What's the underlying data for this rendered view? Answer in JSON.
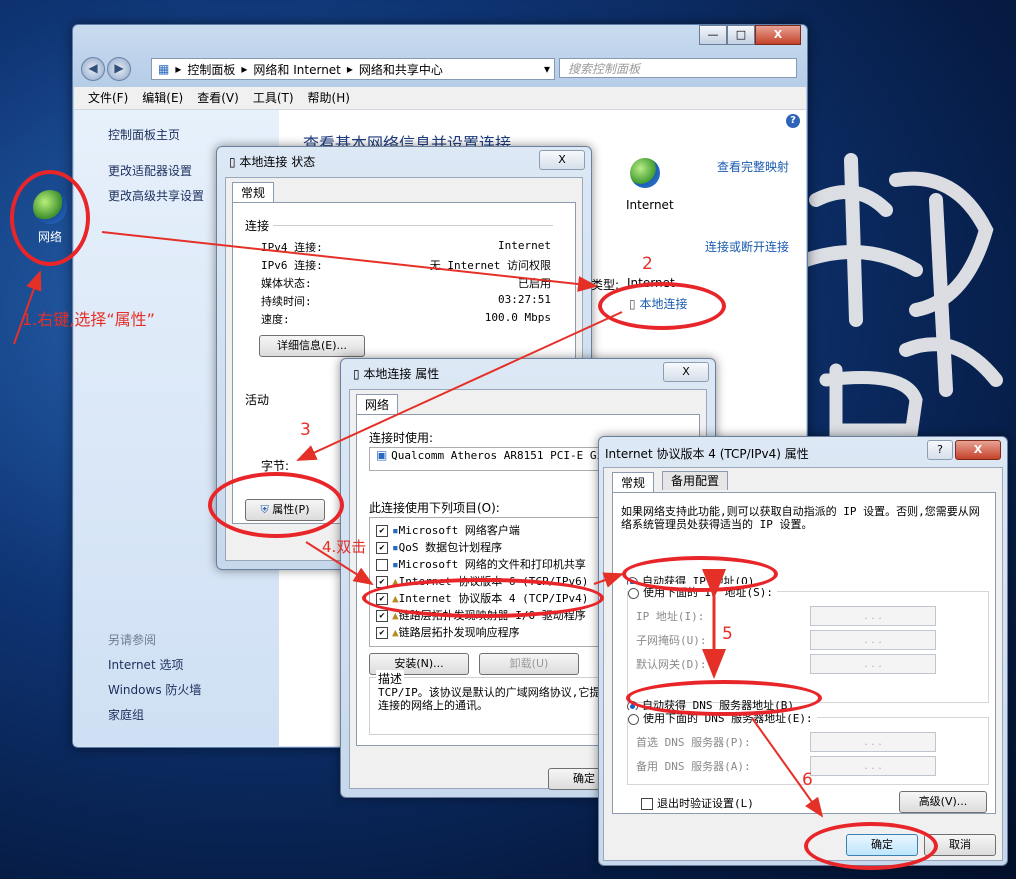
{
  "desktop": {
    "network_icon_label": "网络",
    "calligraphy": "坤 罗"
  },
  "explorer": {
    "title_buttons": {
      "minimize": "—",
      "maximize": "□",
      "close": "X"
    },
    "breadcrumb": [
      "控制面板",
      "网络和 Internet",
      "网络和共享中心"
    ],
    "search_placeholder": "搜索控制面板",
    "menu": [
      "文件(F)",
      "编辑(E)",
      "查看(V)",
      "工具(T)",
      "帮助(H)"
    ],
    "sidebar": {
      "items": [
        "控制面板主页",
        "更改适配器设置",
        "更改高级共享设置"
      ],
      "see_also_header": "另请参阅",
      "see_also": [
        "Internet 选项",
        "Windows 防火墙",
        "家庭组"
      ]
    },
    "content": {
      "title": "查看基本网络信息并设置连接",
      "view_full_map": "查看完整映射",
      "internet_label": "Internet",
      "connect_disconnect": "连接或断开连接",
      "type_label": "类型:",
      "type_value": "Internet",
      "local_connection_link": "本地连接"
    }
  },
  "status_dialog": {
    "title": "本地连接 状态",
    "tab": "常规",
    "section_connection": "连接",
    "rows": [
      {
        "label": "IPv4 连接:",
        "value": "Internet"
      },
      {
        "label": "IPv6 连接:",
        "value": "无 Internet 访问权限"
      },
      {
        "label": "媒体状态:",
        "value": "已启用"
      },
      {
        "label": "持续时间:",
        "value": "03:27:51"
      },
      {
        "label": "速度:",
        "value": "100.0 Mbps"
      }
    ],
    "details_button": "详细信息(E)...",
    "section_activity": "活动",
    "bytes_label": "字节:",
    "properties_button": "属性(P)"
  },
  "props_dialog": {
    "title": "本地连接 属性",
    "tab": "网络",
    "connect_using_label": "连接时使用:",
    "adapter": "Qualcomm Atheros AR8151 PCI-E Gig",
    "items_label": "此连接使用下列项目(O):",
    "items": [
      "Microsoft 网络客户端",
      "QoS 数据包计划程序",
      "Microsoft 网络的文件和打印机共享",
      "Internet 协议版本 6 (TCP/IPv6)",
      "Internet 协议版本 4 (TCP/IPv4)",
      "链路层拓扑发现映射器 I/O 驱动程序",
      "链路层拓扑发现响应程序"
    ],
    "install_button": "安装(N)...",
    "uninstall_button": "卸载(U)",
    "description_label": "描述",
    "description": "TCP/IP。该协议是默认的广域网络协议,它提供在不同的相互连接的网络上的通讯。",
    "ok_button": "确定"
  },
  "ipv4_dialog": {
    "title": "Internet 协议版本 4 (TCP/IPv4) 属性",
    "help_button": "?",
    "close_button": "X",
    "tabs": [
      "常规",
      "备用配置"
    ],
    "intro": "如果网络支持此功能,则可以获取自动指派的 IP 设置。否则,您需要从网络系统管理员处获得适当的 IP 设置。",
    "auto_ip": "自动获得 IP 地址(O)",
    "manual_ip": "使用下面的 IP 地址(S):",
    "ip_fields": [
      "IP 地址(I):",
      "子网掩码(U):",
      "默认网关(D):"
    ],
    "auto_dns": "自动获得 DNS 服务器地址(B)",
    "manual_dns": "使用下面的 DNS 服务器地址(E):",
    "dns_fields": [
      "首选 DNS 服务器(P):",
      "备用 DNS 服务器(A):"
    ],
    "field_placeholder": ". . .",
    "validate_on_exit": "退出时验证设置(L)",
    "advanced_button": "高级(V)...",
    "ok_button": "确定",
    "cancel_button": "取消"
  },
  "annotations": {
    "step1": "1.右键,选择“属性”",
    "step2": "2",
    "step3": "3",
    "step4": "4.双击",
    "step5": "5",
    "step6": "6",
    "color": "#e53028"
  }
}
